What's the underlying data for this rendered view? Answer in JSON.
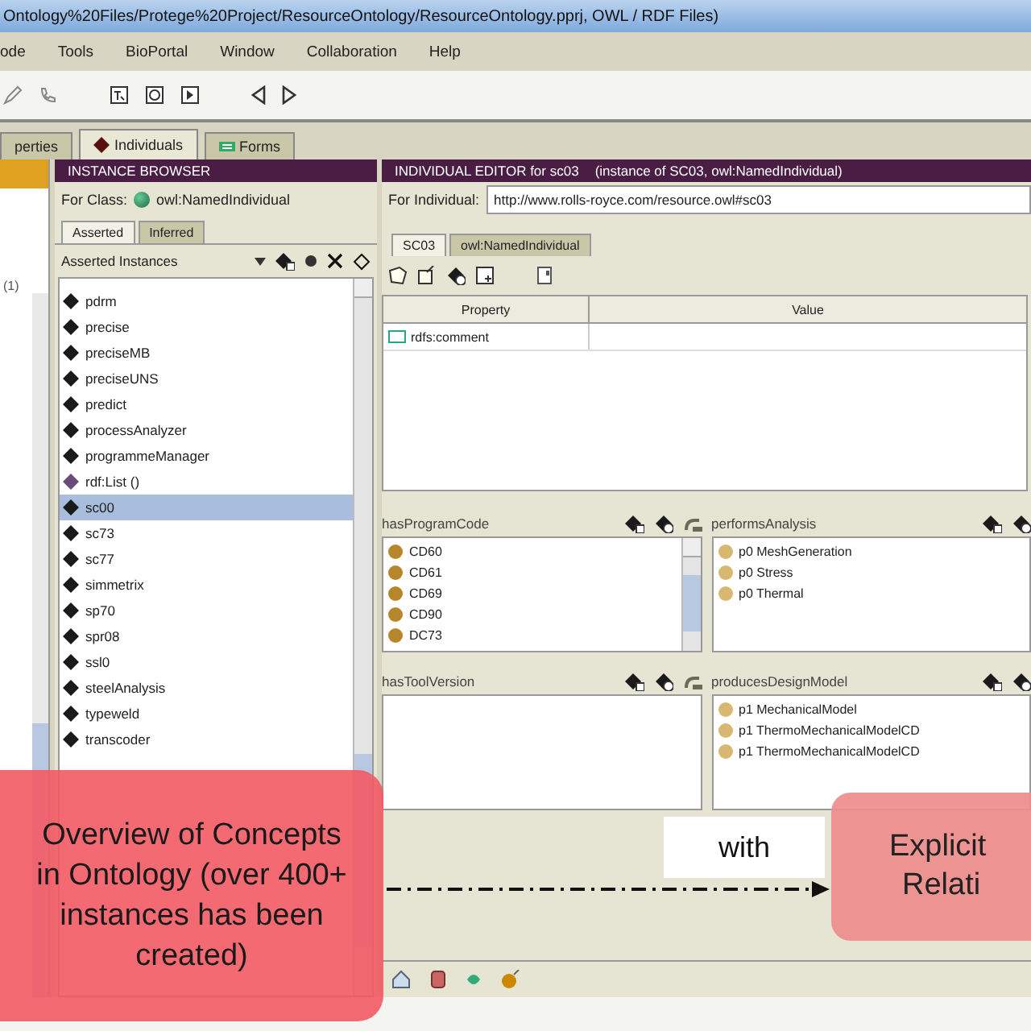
{
  "window": {
    "title": "Ontology%20Files/Protege%20Project/ResourceOntology/ResourceOntology.pprj, OWL / RDF Files)"
  },
  "menu": [
    "ode",
    "Tools",
    "BioPortal",
    "Window",
    "Collaboration",
    "Help"
  ],
  "tabs": [
    {
      "label": "perties",
      "selected": false
    },
    {
      "label": "Individuals",
      "selected": true
    },
    {
      "label": "Forms",
      "selected": false
    }
  ],
  "class_tree": {
    "count": "(1)"
  },
  "instance_browser": {
    "title": "INSTANCE BROWSER",
    "for_class_label": "For Class:",
    "for_class": "owl:NamedIndividual",
    "tabs": [
      {
        "label": "Asserted",
        "selected": true
      },
      {
        "label": "Inferred",
        "selected": false
      }
    ],
    "list_title": "Asserted Instances",
    "instances": [
      {
        "name": "pdrm",
        "selected": false,
        "color": "#1a1a1a"
      },
      {
        "name": "precise",
        "selected": false,
        "color": "#1a1a1a"
      },
      {
        "name": "preciseMB",
        "selected": false,
        "color": "#1a1a1a"
      },
      {
        "name": "preciseUNS",
        "selected": false,
        "color": "#1a1a1a"
      },
      {
        "name": "predict",
        "selected": false,
        "color": "#1a1a1a"
      },
      {
        "name": "processAnalyzer",
        "selected": false,
        "color": "#1a1a1a"
      },
      {
        "name": "programmeManager",
        "selected": false,
        "color": "#1a1a1a"
      },
      {
        "name": "rdf:List ()",
        "selected": false,
        "color": "#6a4c7a"
      },
      {
        "name": "sc00",
        "selected": true,
        "color": "#1a1a1a"
      },
      {
        "name": "sc73",
        "selected": false,
        "color": "#1a1a1a"
      },
      {
        "name": "sc77",
        "selected": false,
        "color": "#1a1a1a"
      },
      {
        "name": "simmetrix",
        "selected": false,
        "color": "#1a1a1a"
      },
      {
        "name": "sp70",
        "selected": false,
        "color": "#1a1a1a"
      },
      {
        "name": "spr08",
        "selected": false,
        "color": "#1a1a1a"
      },
      {
        "name": "ssl0",
        "selected": false,
        "color": "#1a1a1a"
      },
      {
        "name": "steelAnalysis",
        "selected": false,
        "color": "#1a1a1a"
      },
      {
        "name": "typeweld",
        "selected": false,
        "color": "#1a1a1a"
      },
      {
        "name": "transcoder",
        "selected": false,
        "color": "#1a1a1a"
      }
    ]
  },
  "individual_editor": {
    "title": "INDIVIDUAL EDITOR for sc03",
    "subtitle": "(instance of SC03, owl:NamedIndividual)",
    "for_label": "For Individual:",
    "uri": "http://www.rolls-royce.com/resource.owl#sc03",
    "tabs": [
      {
        "label": "SC03",
        "selected": true
      },
      {
        "label": "owl:NamedIndividual",
        "selected": false
      }
    ],
    "table": {
      "columns": [
        "Property",
        "Value"
      ],
      "rows": [
        {
          "property": "rdfs:comment"
        }
      ]
    },
    "panels": [
      {
        "title": "hasProgramCode",
        "items": [
          "CD60",
          "CD61",
          "CD69",
          "CD90",
          "DC73"
        ]
      },
      {
        "title": "performsAnalysis",
        "items": [
          "p0 MeshGeneration",
          "p0 Stress",
          "p0 Thermal"
        ]
      },
      {
        "title": "hasToolVersion"
      },
      {
        "title": "producesDesignModel",
        "items": [
          "p1 MechanicalModel",
          "p1 ThermoMechanicalModelCD",
          "p1 ThermoMechanicalModelCD"
        ]
      }
    ]
  },
  "annotations": {
    "overview": "Overview of Concepts in Ontology (over 400+ instances has been created)",
    "connector_label": "with",
    "target_lines": [
      "Explicit",
      "Relati"
    ]
  }
}
